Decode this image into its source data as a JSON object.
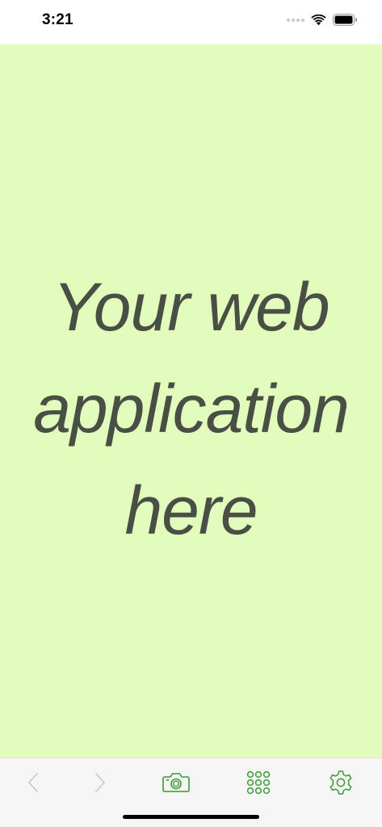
{
  "status_bar": {
    "time": "3:21",
    "icons": [
      "signal-dots-icon",
      "wifi-icon",
      "battery-icon"
    ]
  },
  "webview": {
    "lines": [
      "Your web",
      "application",
      "here"
    ],
    "background_color": "#e2fcbc",
    "text_color": "#4a4f46"
  },
  "toolbar": {
    "buttons": [
      {
        "icon": "chevron-left-icon",
        "enabled": false
      },
      {
        "icon": "chevron-right-icon",
        "enabled": false
      },
      {
        "icon": "camera-icon",
        "enabled": true
      },
      {
        "icon": "grid-icon",
        "enabled": true
      },
      {
        "icon": "gear-icon",
        "enabled": true
      }
    ],
    "accent_color": "#3a9a3a",
    "disabled_color": "#c8c8c8"
  }
}
